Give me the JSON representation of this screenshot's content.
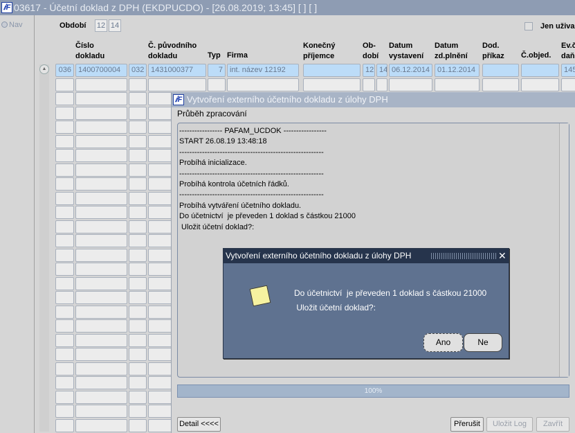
{
  "window": {
    "title": "03617 - Účetní doklad z DPH (EKDPUCDO) - [26.08.2019; 13:45]  [ ]  [ ]",
    "logo": "IF"
  },
  "nav": {
    "label": "Nav"
  },
  "filter": {
    "obdobi_label": "Období",
    "obdobi_values": [
      "12",
      "14"
    ],
    "jen_label": "Jen uživa"
  },
  "grid": {
    "headers": [
      "Číslo\ndokladu",
      "Č. původního\ndokladu",
      "Typ",
      "Firma",
      "Konečný\npříjemce",
      "Ob-\ndobí",
      "Datum\nvystavení",
      "Datum\nzd.plnění",
      "Dod.\npříkaz",
      "Č.objed.",
      "Ev.č\ndaň"
    ],
    "row1": [
      "036",
      "1400700004",
      "032",
      "1431000377",
      "7",
      "int. název 12192",
      "",
      "12",
      "14",
      "06.12.2014",
      "01.12.2014",
      "",
      "",
      "145"
    ]
  },
  "progress_window": {
    "title": "Vytvoření externího účetního dokladu z úlohy DPH",
    "section_label": "Průběh zpracování",
    "log_lines": [
      "----------------- PAFAM_UCDOK -----------------",
      "START 26.08.19 13:48:18",
      "---------------------------------------------------------",
      "Probíhá inicializace.",
      "---------------------------------------------------------",
      "Probíhá kontrola účetních řádků.",
      "---------------------------------------------------------",
      "Probíhá vytváření účetního dokladu.",
      "Do účetnictví  je převeden 1 doklad s částkou 21000",
      " Uložit účetní doklad?:"
    ],
    "progress_percent": 100,
    "progress_label": "100%",
    "detail_button": "Detail <<<<",
    "abort_button": "Přerušit",
    "save_log_button": "Uložit Log",
    "close_button": "Zavřít"
  },
  "modal": {
    "title": "Vytvoření externího účetního dokladu z úlohy DPH",
    "message": "Do účetnictví  je převeden 1 doklad s částkou 21000\n Uložit účetní doklad?:",
    "yes_button": "Ano",
    "no_button": "Ne"
  }
}
